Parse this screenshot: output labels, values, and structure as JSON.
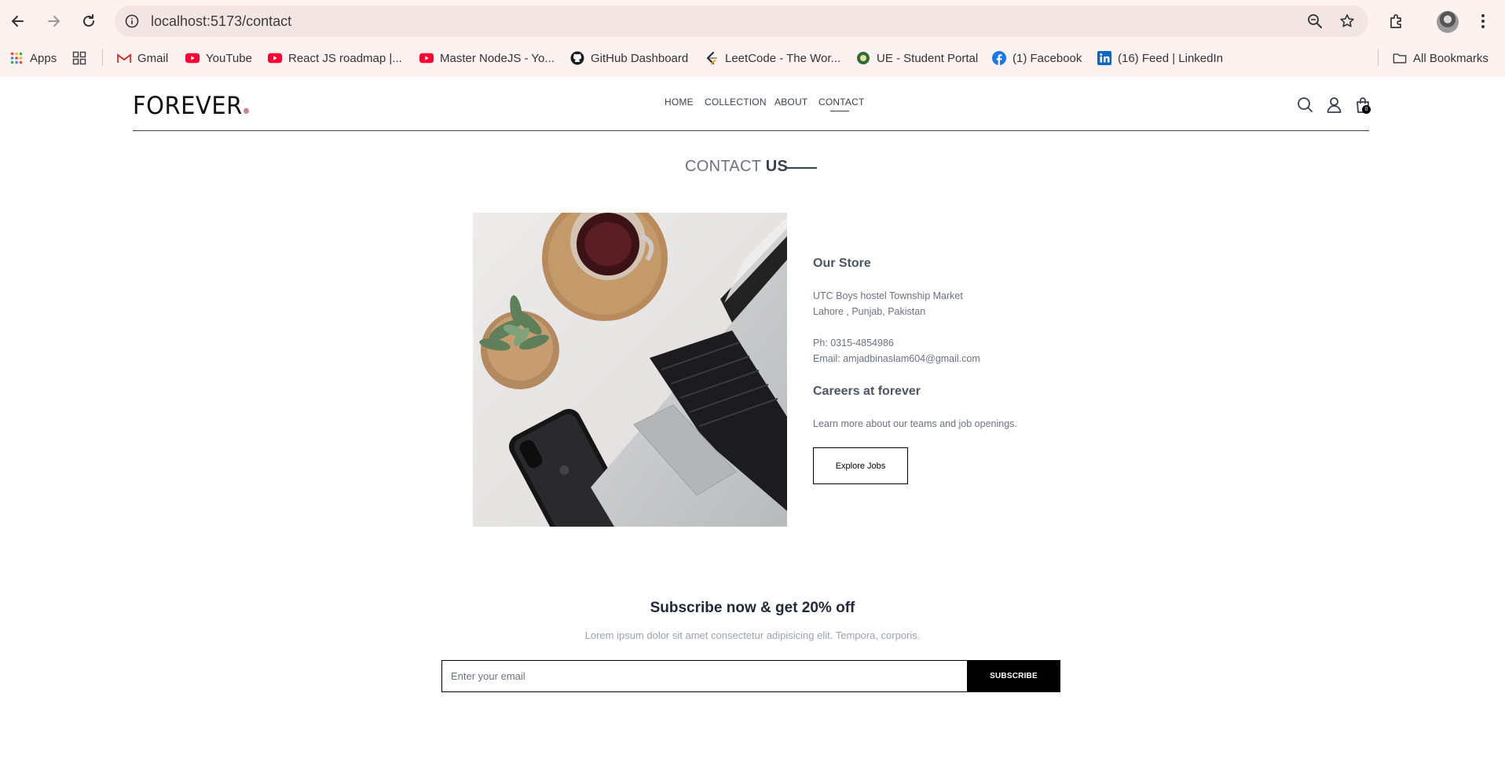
{
  "browser": {
    "url": "localhost:5173/contact",
    "bookmarks": [
      {
        "label": "Apps",
        "icon": "apps-grid-icon"
      },
      {
        "label": "Gmail",
        "icon": "gmail-icon"
      },
      {
        "label": "YouTube",
        "icon": "youtube-icon"
      },
      {
        "label": "React JS roadmap |...",
        "icon": "youtube-icon"
      },
      {
        "label": "Master NodeJS - Yo...",
        "icon": "youtube-icon"
      },
      {
        "label": "GitHub Dashboard",
        "icon": "github-icon"
      },
      {
        "label": "LeetCode - The Wor...",
        "icon": "leetcode-icon"
      },
      {
        "label": "UE - Student Portal",
        "icon": "ue-icon"
      },
      {
        "label": "(1) Facebook",
        "icon": "facebook-icon"
      },
      {
        "label": "(16) Feed | LinkedIn",
        "icon": "linkedin-icon"
      }
    ],
    "all_bookmarks": "All Bookmarks"
  },
  "site": {
    "logo": "FOREVER",
    "nav": [
      "HOME",
      "COLLECTION",
      "ABOUT",
      "CONTACT"
    ],
    "active_nav": "CONTACT",
    "cart_count": "0",
    "accent_color": "#c586a5"
  },
  "page": {
    "title_light": "CONTACT",
    "title_bold": "US"
  },
  "store": {
    "heading": "Our Store",
    "address_line1": "UTC Boys hostel Township Market",
    "address_line2": "Lahore , Punjab, Pakistan",
    "phone": "Ph: 0315-4854986",
    "email": "Email: amjadbinaslam604@gmail.com"
  },
  "careers": {
    "heading": "Careers at forever",
    "text": "Learn more about our teams and job openings.",
    "button": "Explore Jobs"
  },
  "newsletter": {
    "title": "Subscribe now & get 20% off",
    "text": "Lorem ipsum dolor sit amet consectetur adipisicing elit. Tempora, corporis.",
    "placeholder": "Enter your email",
    "button": "SUBSCRIBE"
  }
}
